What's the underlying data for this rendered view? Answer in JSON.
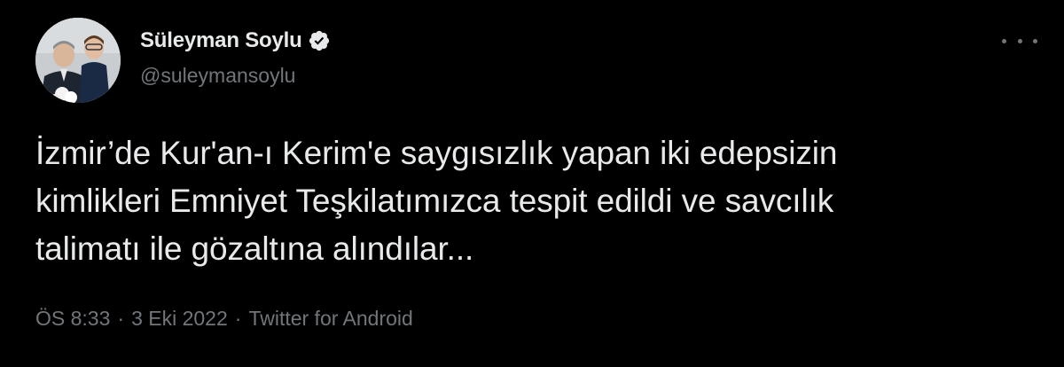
{
  "author": {
    "display_name": "Süleyman Soylu",
    "handle": "@suleymansoylu",
    "verified": true
  },
  "icons": {
    "verified": "verified-badge-icon",
    "more": "more-options-icon"
  },
  "tweet": {
    "text_lines": [
      "İzmir’de Kur'an-ı Kerim'e saygısızlık yapan iki edepsizin",
      "kimlikleri Emniyet Teşkilatımızca tespit edildi ve savcılık",
      "talimatı ile gözaltına alındılar..."
    ]
  },
  "meta": {
    "time": "ÖS 8:33",
    "separator": "·",
    "date": "3 Eki 2022",
    "source": "Twitter for Android"
  },
  "colors": {
    "background": "#000000",
    "primary_text": "#e7e9ea",
    "secondary_text": "#71767b",
    "verified_badge": "#e7e9ea"
  }
}
